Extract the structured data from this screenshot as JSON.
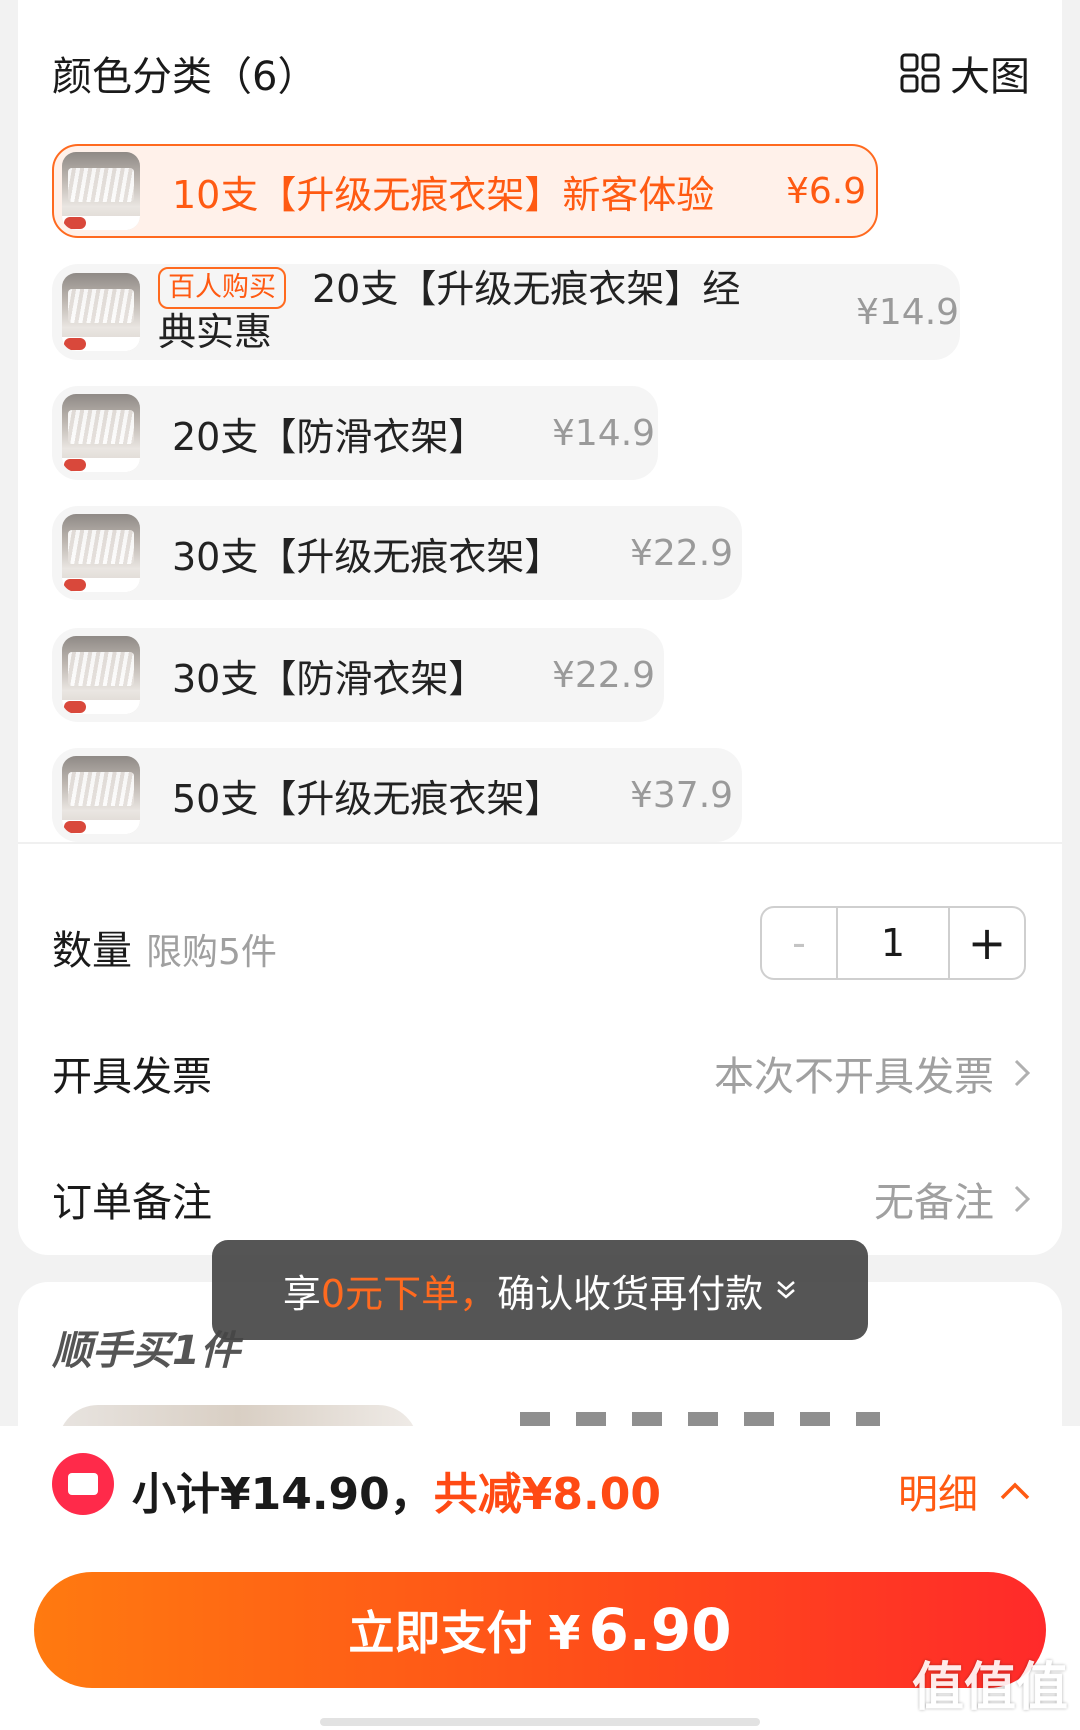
{
  "header": {
    "title": "颜色分类（6）",
    "big_view_label": "大图",
    "big_view_icon": "grid-icon"
  },
  "skus": [
    {
      "label": "10支【升级无痕衣架】新客体验",
      "price": "¥6.9",
      "selected": true
    },
    {
      "badge": "百人购买",
      "label_line1": "20支【升级无痕衣架】经",
      "label_line2": "典实惠",
      "price": "¥14.9",
      "selected": false
    },
    {
      "label": "20支【防滑衣架】",
      "price": "¥14.9",
      "selected": false
    },
    {
      "label": "30支【升级无痕衣架】",
      "price": "¥22.9",
      "selected": false
    },
    {
      "label": "30支【防滑衣架】",
      "price": "¥22.9",
      "selected": false
    },
    {
      "label": "50支【升级无痕衣架】",
      "price": "¥37.9",
      "selected": false
    }
  ],
  "quantity": {
    "label": "数量",
    "limit": "限购5件",
    "minus": "-",
    "value": "1",
    "plus": "+"
  },
  "invoice": {
    "label": "开具发票",
    "value": "本次不开具发票"
  },
  "remark": {
    "label": "订单备注",
    "value": "无备注"
  },
  "toast": {
    "prefix": "享",
    "highlight": "0元下单，",
    "suffix": "确认收货再付款"
  },
  "addon": {
    "title": "顺手买1件"
  },
  "summary": {
    "subtotal": "小计¥14.90，",
    "discount": "共减¥8.00",
    "detail": "明细"
  },
  "pay_button": {
    "label": "立即支付 ¥",
    "amount": "6.90"
  },
  "watermark": "值值值",
  "colors": {
    "accent": "#ff5a12",
    "selected_bg": "#fff1ea",
    "coupon": "#ff2a4a"
  }
}
